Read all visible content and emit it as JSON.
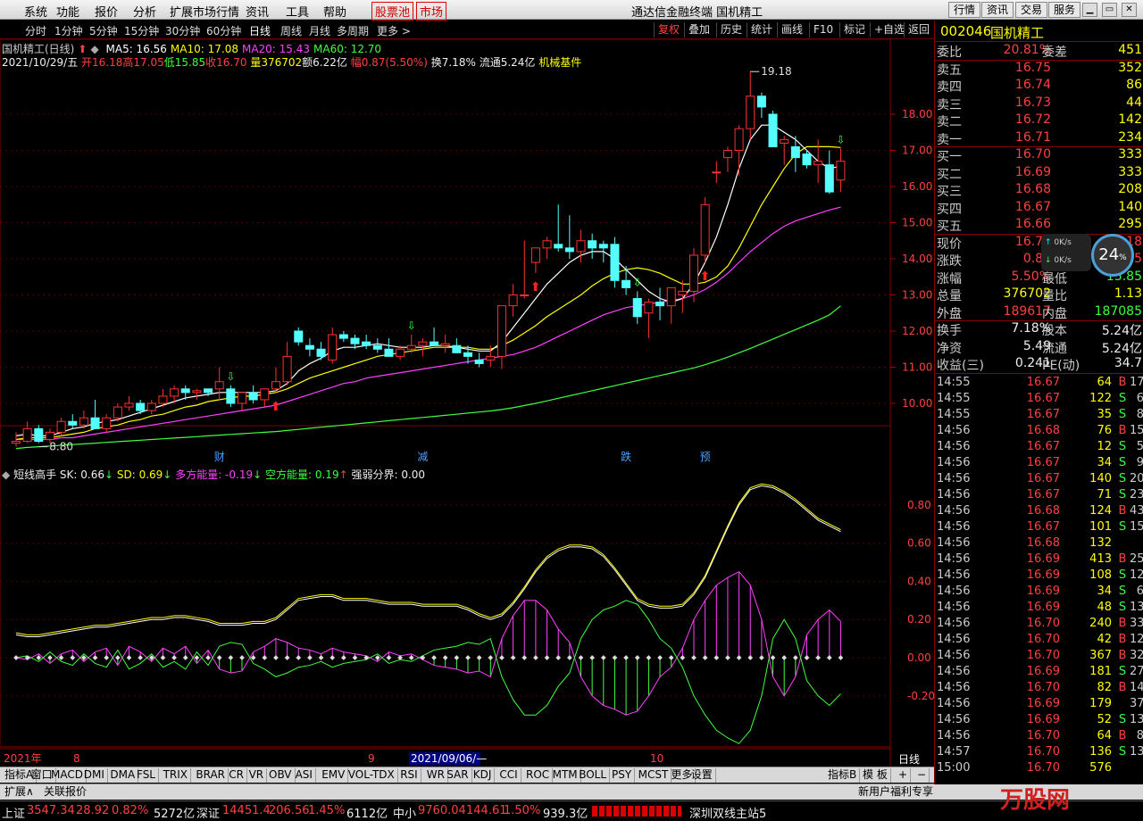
{
  "menu": {
    "items": [
      "系统",
      "功能",
      "报价",
      "分析",
      "扩展市场行情",
      "资讯",
      "工具",
      "帮助"
    ],
    "stock_pool": "股票池",
    "market": "市场",
    "title": "通达信金融终端 国机精工",
    "right": [
      "行情",
      "资讯",
      "交易",
      "服务"
    ]
  },
  "toolbar": {
    "periods": [
      "分时",
      "1分钟",
      "5分钟",
      "15分钟",
      "30分钟",
      "60分钟",
      "日线",
      "周线",
      "月线",
      "多周期",
      "更多 >"
    ],
    "right": [
      "复权",
      "叠加",
      "历史",
      "统计",
      "画线",
      "F10",
      "标记",
      "+自选",
      "返回"
    ]
  },
  "chart": {
    "name": "国机精工(日线)",
    "ma": [
      {
        "label": "MA5: 16.56",
        "color": "#ffffff"
      },
      {
        "label": "MA10: 17.08",
        "color": "#ffff00"
      },
      {
        "label": "MA20: 15.43",
        "color": "#ff40ff"
      },
      {
        "label": "MA60: 12.70",
        "color": "#40ff40"
      }
    ],
    "info": {
      "date": "2021/10/29/五",
      "open": "开16.18",
      "high": "高17.05",
      "low": "低15.85",
      "close": "收16.70",
      "vol": "量376702",
      "amt": "额6.22亿",
      "chg": "幅0.87(5.50%)",
      "turn": "换7.18%",
      "float": "流通5.24亿",
      "sector": "机械基件"
    },
    "yticks": [
      "18.00",
      "17.00",
      "16.00",
      "15.00",
      "14.00",
      "13.00",
      "12.00",
      "11.00",
      "10.00"
    ],
    "high_label": "19.18",
    "low_label": "8.80",
    "events": [
      "财",
      "减",
      "跌",
      "预"
    ],
    "candles": [
      [
        8.9,
        9.2,
        8.8,
        8.95
      ],
      [
        8.95,
        9.5,
        8.9,
        9.3
      ],
      [
        9.3,
        9.4,
        8.9,
        8.95
      ],
      [
        9.0,
        9.3,
        8.9,
        9.2
      ],
      [
        9.2,
        9.6,
        9.1,
        9.5
      ],
      [
        9.5,
        9.7,
        9.3,
        9.4
      ],
      [
        9.4,
        9.8,
        9.3,
        9.6
      ],
      [
        9.6,
        10.1,
        9.5,
        9.3
      ],
      [
        9.3,
        9.7,
        9.2,
        9.6
      ],
      [
        9.6,
        10.0,
        9.5,
        9.9
      ],
      [
        9.9,
        10.2,
        9.8,
        10.0
      ],
      [
        10.0,
        10.1,
        9.7,
        9.8
      ],
      [
        9.8,
        10.1,
        9.7,
        10.0
      ],
      [
        10.0,
        10.4,
        9.9,
        10.2
      ],
      [
        10.2,
        10.5,
        10.0,
        10.4
      ],
      [
        10.4,
        10.5,
        10.1,
        10.3
      ],
      [
        10.3,
        10.4,
        10.1,
        10.35
      ],
      [
        10.4,
        10.4,
        10.2,
        10.3
      ],
      [
        10.4,
        11.0,
        10.1,
        10.6
      ],
      [
        10.4,
        10.5,
        9.9,
        10.0
      ],
      [
        10.0,
        10.2,
        9.8,
        10.3
      ],
      [
        10.3,
        10.5,
        10.0,
        10.1
      ],
      [
        10.1,
        10.4,
        9.9,
        10.4
      ],
      [
        10.4,
        11.0,
        10.3,
        10.6
      ],
      [
        10.6,
        11.7,
        10.5,
        11.3
      ],
      [
        12.0,
        12.1,
        11.6,
        11.7
      ],
      [
        11.6,
        11.8,
        11.3,
        11.5
      ],
      [
        11.5,
        11.7,
        11.2,
        11.3
      ],
      [
        11.2,
        12.1,
        11.1,
        11.9
      ],
      [
        11.9,
        12.0,
        11.7,
        11.8
      ],
      [
        11.8,
        11.9,
        11.5,
        11.65
      ],
      [
        11.7,
        11.9,
        11.5,
        11.6
      ],
      [
        11.6,
        11.8,
        11.4,
        11.5
      ],
      [
        11.5,
        11.8,
        11.3,
        11.3
      ],
      [
        11.3,
        11.6,
        11.2,
        11.5
      ],
      [
        11.5,
        11.9,
        11.4,
        11.6
      ],
      [
        11.6,
        11.8,
        11.3,
        11.7
      ],
      [
        11.7,
        12.1,
        11.6,
        11.6
      ],
      [
        11.6,
        11.9,
        11.4,
        11.65
      ],
      [
        11.6,
        11.8,
        11.4,
        11.4
      ],
      [
        11.4,
        11.6,
        11.1,
        11.3
      ],
      [
        11.2,
        11.4,
        11.0,
        11.1
      ],
      [
        11.2,
        11.6,
        11.0,
        11.3
      ],
      [
        11.3,
        12.0,
        10.95,
        12.7
      ],
      [
        12.7,
        13.3,
        12.4,
        13.0
      ],
      [
        13.0,
        14.5,
        12.9,
        13.0
      ],
      [
        13.9,
        14.1,
        13.6,
        14.3
      ],
      [
        14.3,
        14.6,
        14.0,
        14.5
      ],
      [
        14.4,
        15.5,
        14.2,
        14.3
      ],
      [
        14.3,
        15.2,
        14.0,
        14.2
      ],
      [
        14.2,
        14.8,
        13.9,
        14.5
      ],
      [
        14.5,
        14.7,
        14.0,
        14.3
      ],
      [
        14.4,
        14.5,
        13.9,
        14.3
      ],
      [
        14.4,
        14.6,
        13.2,
        13.4
      ],
      [
        13.4,
        13.8,
        13.0,
        13.2
      ],
      [
        12.9,
        13.1,
        12.2,
        12.4
      ],
      [
        12.5,
        12.9,
        11.8,
        12.8
      ],
      [
        12.8,
        13.2,
        12.3,
        12.7
      ],
      [
        12.7,
        13.2,
        12.2,
        13.2
      ],
      [
        13.0,
        13.4,
        12.5,
        13.1
      ],
      [
        13.1,
        14.3,
        12.8,
        14.1
      ],
      [
        14.1,
        15.7,
        13.9,
        15.5
      ],
      [
        16.4,
        16.7,
        16.1,
        16.4
      ],
      [
        16.8,
        17.1,
        16.4,
        17.0
      ],
      [
        17.0,
        17.7,
        16.3,
        17.6
      ],
      [
        17.6,
        19.18,
        17.3,
        18.5
      ],
      [
        18.5,
        18.6,
        17.9,
        18.2
      ],
      [
        18.0,
        18.1,
        17.6,
        17.1
      ],
      [
        17.2,
        17.4,
        16.6,
        17.3
      ],
      [
        17.1,
        17.4,
        16.4,
        16.8
      ],
      [
        16.9,
        17.0,
        16.5,
        16.6
      ],
      [
        16.6,
        17.3,
        16.1,
        16.7
      ],
      [
        16.6,
        17.0,
        15.8,
        15.85
      ],
      [
        16.18,
        17.05,
        15.85,
        16.7
      ]
    ],
    "ma5": [
      9.1,
      9.15,
      9.1,
      9.1,
      9.2,
      9.3,
      9.35,
      9.45,
      9.5,
      9.55,
      9.65,
      9.75,
      9.85,
      9.95,
      10.05,
      10.15,
      10.2,
      10.25,
      10.3,
      10.3,
      10.3,
      10.3,
      10.3,
      10.35,
      10.55,
      10.9,
      11.1,
      11.25,
      11.45,
      11.55,
      11.55,
      11.6,
      11.65,
      11.6,
      11.55,
      11.55,
      11.55,
      11.6,
      11.6,
      11.55,
      11.5,
      11.45,
      11.45,
      11.7,
      12.1,
      12.5,
      12.9,
      13.3,
      13.6,
      13.9,
      14.1,
      14.2,
      14.2,
      14.0,
      13.7,
      13.4,
      13.1,
      12.9,
      12.8,
      12.9,
      13.3,
      13.9,
      14.6,
      15.5,
      16.5,
      17.3,
      17.7,
      17.7,
      17.5,
      17.3,
      17.0,
      16.7,
      16.5,
      16.56
    ],
    "ma10": [
      9.0,
      9.05,
      9.05,
      9.05,
      9.1,
      9.15,
      9.2,
      9.3,
      9.35,
      9.4,
      9.5,
      9.55,
      9.65,
      9.7,
      9.8,
      9.9,
      9.95,
      10.05,
      10.1,
      10.15,
      10.2,
      10.2,
      10.25,
      10.3,
      10.4,
      10.55,
      10.7,
      10.8,
      10.9,
      11.0,
      11.1,
      11.2,
      11.3,
      11.35,
      11.4,
      11.45,
      11.5,
      11.55,
      11.55,
      11.55,
      11.55,
      11.5,
      11.5,
      11.6,
      11.75,
      11.95,
      12.15,
      12.4,
      12.6,
      12.8,
      13.0,
      13.25,
      13.45,
      13.6,
      13.7,
      13.75,
      13.7,
      13.6,
      13.45,
      13.3,
      13.3,
      13.35,
      13.5,
      13.8,
      14.3,
      14.9,
      15.5,
      16.0,
      16.5,
      16.9,
      17.1,
      17.1,
      17.1,
      17.08
    ],
    "ma20": [
      9.0,
      9.0,
      9.0,
      9.0,
      9.05,
      9.05,
      9.1,
      9.15,
      9.2,
      9.25,
      9.3,
      9.35,
      9.4,
      9.45,
      9.5,
      9.55,
      9.6,
      9.65,
      9.7,
      9.75,
      9.8,
      9.85,
      9.9,
      9.95,
      10.05,
      10.15,
      10.25,
      10.35,
      10.45,
      10.55,
      10.6,
      10.7,
      10.75,
      10.8,
      10.85,
      10.9,
      10.95,
      11.0,
      11.05,
      11.1,
      11.15,
      11.2,
      11.25,
      11.3,
      11.35,
      11.45,
      11.55,
      11.7,
      11.85,
      12.0,
      12.15,
      12.3,
      12.45,
      12.55,
      12.65,
      12.7,
      12.75,
      12.8,
      12.85,
      12.9,
      13.0,
      13.15,
      13.35,
      13.6,
      13.9,
      14.2,
      14.45,
      14.7,
      14.9,
      15.05,
      15.15,
      15.25,
      15.35,
      15.43
    ],
    "ma60": [
      8.75,
      8.78,
      8.8,
      8.82,
      8.84,
      8.86,
      8.88,
      8.9,
      8.92,
      8.94,
      8.96,
      8.98,
      9.0,
      9.02,
      9.04,
      9.06,
      9.08,
      9.1,
      9.12,
      9.14,
      9.16,
      9.18,
      9.2,
      9.22,
      9.25,
      9.28,
      9.31,
      9.34,
      9.37,
      9.4,
      9.43,
      9.46,
      9.49,
      9.52,
      9.55,
      9.58,
      9.61,
      9.64,
      9.67,
      9.7,
      9.73,
      9.76,
      9.79,
      9.83,
      9.88,
      9.94,
      10.0,
      10.07,
      10.14,
      10.21,
      10.28,
      10.35,
      10.42,
      10.49,
      10.56,
      10.63,
      10.7,
      10.77,
      10.84,
      10.91,
      10.98,
      11.07,
      11.17,
      11.28,
      11.4,
      11.52,
      11.65,
      11.78,
      11.91,
      12.04,
      12.17,
      12.3,
      12.45,
      12.7
    ]
  },
  "indicator": {
    "name": "短线高手",
    "sk": "SK: 0.66",
    "sd": "SD: 0.69",
    "bull": "多方能量: -0.19",
    "bear": "空方能量: 0.19",
    "line": "强弱分界: 0.00",
    "yticks": [
      "0.80",
      "0.60",
      "0.40",
      "0.20",
      "0.00",
      "-0.20"
    ],
    "sk_values": [
      0.12,
      0.11,
      0.11,
      0.12,
      0.13,
      0.14,
      0.15,
      0.16,
      0.16,
      0.17,
      0.18,
      0.19,
      0.2,
      0.2,
      0.21,
      0.21,
      0.2,
      0.19,
      0.17,
      0.17,
      0.17,
      0.18,
      0.18,
      0.2,
      0.25,
      0.3,
      0.31,
      0.32,
      0.32,
      0.3,
      0.3,
      0.3,
      0.29,
      0.28,
      0.28,
      0.28,
      0.27,
      0.27,
      0.27,
      0.27,
      0.25,
      0.22,
      0.2,
      0.22,
      0.28,
      0.36,
      0.45,
      0.52,
      0.56,
      0.58,
      0.58,
      0.57,
      0.53,
      0.46,
      0.38,
      0.3,
      0.27,
      0.26,
      0.26,
      0.27,
      0.33,
      0.42,
      0.55,
      0.68,
      0.8,
      0.88,
      0.9,
      0.89,
      0.86,
      0.82,
      0.77,
      0.72,
      0.69,
      0.66
    ],
    "energy": [
      0.0,
      -0.01,
      0.02,
      -0.03,
      0.02,
      0.04,
      -0.02,
      0.03,
      0.05,
      -0.04,
      0.06,
      0.03,
      -0.02,
      0.05,
      0.02,
      0.06,
      -0.03,
      0.04,
      -0.06,
      -0.08,
      -0.07,
      0.03,
      0.06,
      0.1,
      0.08,
      0.05,
      0.04,
      0.02,
      0.05,
      0.03,
      0.02,
      0.01,
      -0.02,
      0.03,
      0.01,
      0.02,
      -0.01,
      -0.04,
      -0.05,
      -0.06,
      -0.08,
      -0.07,
      -0.1,
      0.1,
      0.22,
      0.3,
      0.3,
      0.25,
      0.15,
      0.08,
      -0.1,
      -0.2,
      -0.25,
      -0.27,
      -0.3,
      -0.28,
      -0.2,
      -0.1,
      -0.05,
      0.05,
      0.2,
      0.3,
      0.38,
      0.42,
      0.45,
      0.38,
      0.2,
      -0.1,
      -0.2,
      -0.1,
      0.12,
      0.2,
      0.25,
      0.19
    ]
  },
  "xaxis": {
    "labels": [
      "2021年",
      "8",
      "9",
      "10"
    ],
    "cursor": "2021/09/06/—",
    "period": "日线"
  },
  "tabs": [
    "指标A",
    "窗口",
    "MACD",
    "DMI",
    "DMA",
    "FSL",
    "TRIX",
    "BRAR",
    "CR",
    "VR",
    "OBV",
    "ASI",
    "EMV",
    "VOL-TDX",
    "RSI",
    "WR",
    "SAR",
    "KDJ",
    "CCI",
    "ROC",
    "MTM",
    "BOLL",
    "PSY",
    "MCST",
    "更多",
    "设置"
  ],
  "tabs_right": [
    "指标B",
    "模 板",
    "+",
    "−"
  ],
  "bottom2": [
    "扩展∧",
    "关联报价"
  ],
  "bottom2_right": "新用户福利专享",
  "quote": {
    "code": "002046",
    "name": "国机精工",
    "weibi": {
      "label": "委比",
      "value": "20.81%",
      "label2": "委差",
      "value2": "451"
    },
    "asks": [
      {
        "l": "卖五",
        "p": "16.75",
        "v": "352"
      },
      {
        "l": "卖四",
        "p": "16.74",
        "v": "86"
      },
      {
        "l": "卖三",
        "p": "16.73",
        "v": "44"
      },
      {
        "l": "卖二",
        "p": "16.72",
        "v": "142"
      },
      {
        "l": "卖一",
        "p": "16.71",
        "v": "234"
      }
    ],
    "bids": [
      {
        "l": "买一",
        "p": "16.70",
        "v": "333"
      },
      {
        "l": "买二",
        "p": "16.69",
        "v": "333"
      },
      {
        "l": "买三",
        "p": "16.68",
        "v": "208"
      },
      {
        "l": "买四",
        "p": "16.67",
        "v": "140"
      },
      {
        "l": "买五",
        "p": "16.66",
        "v": "295"
      }
    ],
    "stats": [
      {
        "l": "现价",
        "v": "16.70",
        "l2": "今开",
        "v2": "16.18"
      },
      {
        "l": "涨跌",
        "v": "0.87",
        "l2": "最高",
        "v2": "17.05"
      },
      {
        "l": "涨幅",
        "v": "5.50%",
        "l2": "最低",
        "v2": "15.85"
      },
      {
        "l": "总量",
        "v": "376702",
        "l2": "量比",
        "v2": "1.13"
      },
      {
        "l": "外盘",
        "v": "189617",
        "l2": "内盘",
        "v2": "187085"
      }
    ],
    "stats2": [
      {
        "l": "换手",
        "v": "7.18%",
        "l2": "股本",
        "v2": "5.24亿"
      },
      {
        "l": "净资",
        "v": "5.49",
        "l2": "流通",
        "v2": "5.24亿"
      },
      {
        "l": "收益(三)",
        "v": "0.241",
        "l2": "PE(动)",
        "v2": "34.7"
      }
    ],
    "ticks": [
      [
        "14:55",
        "16.67",
        "64",
        "B",
        "17"
      ],
      [
        "14:55",
        "16.67",
        "122",
        "S",
        "6"
      ],
      [
        "14:55",
        "16.67",
        "35",
        "S",
        "8"
      ],
      [
        "14:56",
        "16.68",
        "76",
        "B",
        "15"
      ],
      [
        "14:56",
        "16.67",
        "12",
        "S",
        "5"
      ],
      [
        "14:56",
        "16.67",
        "34",
        "S",
        "9"
      ],
      [
        "14:56",
        "16.67",
        "140",
        "S",
        "20"
      ],
      [
        "14:56",
        "16.67",
        "71",
        "S",
        "23"
      ],
      [
        "14:56",
        "16.68",
        "124",
        "B",
        "43"
      ],
      [
        "14:56",
        "16.67",
        "101",
        "S",
        "15"
      ],
      [
        "14:56",
        "16.68",
        "132",
        "",
        ""
      ],
      [
        "14:56",
        "16.69",
        "413",
        "B",
        "25"
      ],
      [
        "14:56",
        "16.69",
        "108",
        "S",
        "12"
      ],
      [
        "14:56",
        "16.69",
        "34",
        "S",
        "6"
      ],
      [
        "14:56",
        "16.69",
        "48",
        "S",
        "13"
      ],
      [
        "14:56",
        "16.70",
        "240",
        "B",
        "33"
      ],
      [
        "14:56",
        "16.70",
        "42",
        "B",
        "12"
      ],
      [
        "14:56",
        "16.70",
        "367",
        "B",
        "32"
      ],
      [
        "14:56",
        "16.69",
        "181",
        "S",
        "27"
      ],
      [
        "14:56",
        "16.70",
        "82",
        "B",
        "14"
      ],
      [
        "14:56",
        "16.69",
        "179",
        "",
        "37"
      ],
      [
        "14:56",
        "16.69",
        "52",
        "S",
        "13"
      ],
      [
        "14:56",
        "16.70",
        "64",
        "B",
        "8"
      ],
      [
        "14:57",
        "16.70",
        "136",
        "S",
        "13"
      ],
      [
        "15:00",
        "16.70",
        "576",
        "",
        ""
      ]
    ]
  },
  "netspeed": {
    "up": "0K/s",
    "down": "0K/s",
    "cpu": "24"
  },
  "status": {
    "sh": {
      "l": "上证",
      "v": "3547.34",
      "c": "28.92",
      "p": "0.82%",
      "a": "5272亿"
    },
    "sz": {
      "l": "深证",
      "v": "14451.4",
      "c": "206.56",
      "p": "1.45%",
      "a": "6112亿"
    },
    "zx": {
      "l": "中小",
      "v": "9760.04",
      "c": "144.61",
      "p": "1.50%",
      "a": "939.3亿"
    },
    "server": "深圳双线主站5",
    "watermark": "万股网"
  }
}
